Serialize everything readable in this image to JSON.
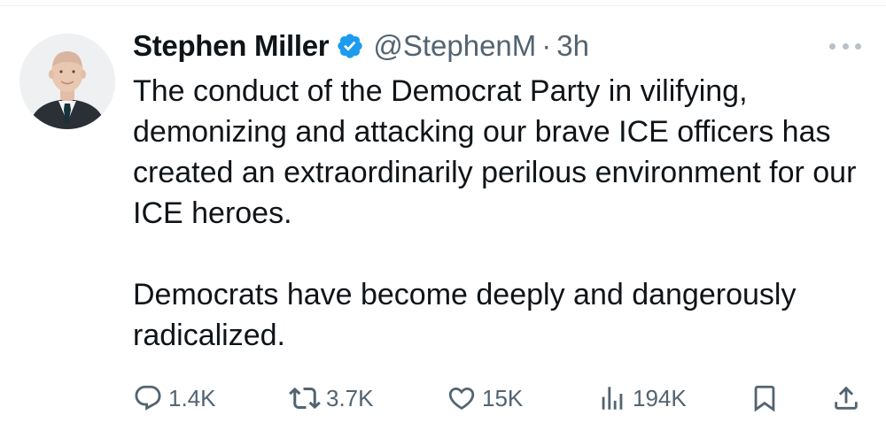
{
  "tweet": {
    "author": {
      "display_name": "Stephen Miller",
      "verified": true,
      "handle": "@StephenM",
      "separator": "·",
      "time": "3h"
    },
    "body": {
      "paragraph_1": "The conduct of the Democrat Party in vilifying, demonizing and attacking our brave ICE officers has created an extraordinarily perilous environment for our ICE heroes.",
      "paragraph_2": "Democrats have become deeply and dangerously radicalized."
    },
    "stats": {
      "replies": "1.4K",
      "reposts": "3.7K",
      "likes": "15K",
      "views": "194K"
    }
  },
  "icons": {
    "reply": "reply-icon",
    "repost": "repost-icon",
    "like": "heart-icon",
    "views": "views-chart-icon",
    "bookmark": "bookmark-icon",
    "share": "share-icon",
    "verified": "verified-badge-icon",
    "more": "more-dots-icon"
  },
  "colors": {
    "text": "#0f1419",
    "secondary": "#536471",
    "verified_blue": "#1d9bf0",
    "icon_gray": "#536471"
  }
}
